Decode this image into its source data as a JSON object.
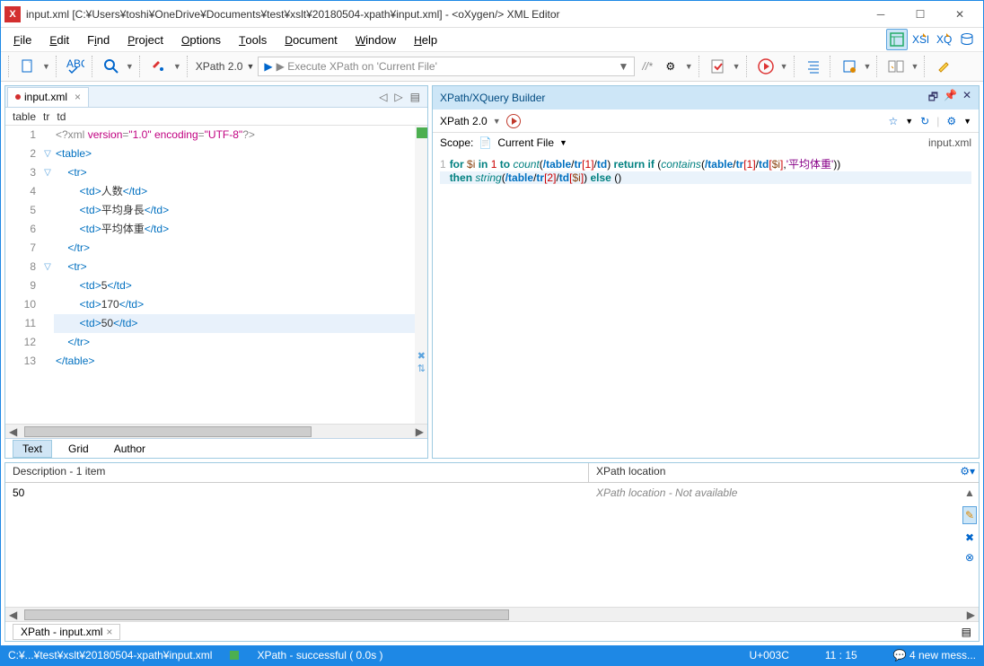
{
  "title": "input.xml [C:¥Users¥toshi¥OneDrive¥Documents¥test¥xslt¥20180504-xpath¥input.xml] - <oXygen/> XML Editor",
  "menus": [
    "File",
    "Edit",
    "Find",
    "Project",
    "Options",
    "Tools",
    "Document",
    "Window",
    "Help"
  ],
  "xpath_version": "XPath 2.0",
  "xpath_placeholder": "▶ Execute XPath on  'Current File'",
  "tab_name": "input.xml",
  "breadcrumb": [
    "table",
    "tr",
    "td"
  ],
  "code": {
    "lines": 13,
    "l1": "<?xml version=\"1.0\" encoding=\"UTF-8\"?>",
    "l2": "<table>",
    "l3": "    <tr>",
    "l4": "        <td>人数</td>",
    "l5": "        <td>平均身長</td>",
    "l6": "        <td>平均体重</td>",
    "l7": "    </tr>",
    "l8": "    <tr>",
    "l9": "        <td>5</td>",
    "l10": "        <td>170</td>",
    "l11": "        <td>50</td>",
    "l12": "    </tr>",
    "l13": "</table>"
  },
  "view_tabs": [
    "Text",
    "Grid",
    "Author"
  ],
  "xpath_builder": {
    "title": "XPath/XQuery Builder",
    "version": "XPath 2.0",
    "scope_label": "Scope:",
    "scope_value": "Current File",
    "scope_right": "input.xml",
    "line1_raw": "for $i in 1 to count(/table/tr[1]/td) return if (contains(/table/tr[1]/td[$i],'平均体重'))",
    "line2_raw": "then string(/table/tr[2]/td[$i]) else ()"
  },
  "results": {
    "desc_header": "Description - 1 item",
    "loc_header": "XPath location",
    "desc_value": "50",
    "loc_value": "XPath location - Not available",
    "tab": "XPath - input.xml"
  },
  "status": {
    "path": "C:¥...¥test¥xslt¥20180504-xpath¥input.xml",
    "xpath": "XPath - successful ( 0.0s )",
    "unicode": "U+003C",
    "pos": "11 : 15",
    "msgs": "4 new mess..."
  }
}
